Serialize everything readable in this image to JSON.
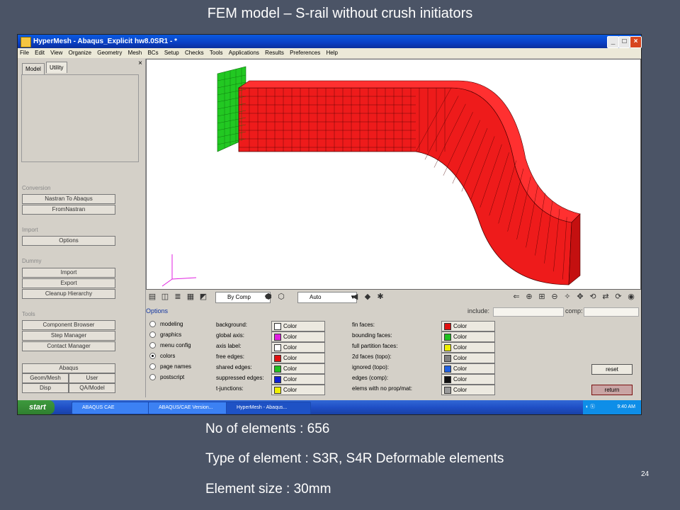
{
  "slide": {
    "title": "FEM model – S-rail without crush initiators",
    "page_number": "24",
    "bullets": [
      "No of elements : 656",
      "Type of element : S3R, S4R Deformable elements",
      "Element size : 30mm"
    ]
  },
  "window": {
    "title": "HyperMesh - Abaqus_Explicit hw8.0SR1 - *",
    "buttons": {
      "minimize": "_",
      "maximize": "□",
      "close": "×"
    }
  },
  "menu": [
    "File",
    "Edit",
    "View",
    "Organize",
    "Geometry",
    "Mesh",
    "BCs",
    "Setup",
    "Checks",
    "Tools",
    "Applications",
    "Results",
    "Preferences",
    "Help"
  ],
  "left_panel": {
    "tabs": [
      "Model",
      "Utility"
    ],
    "close": "×",
    "sections": {
      "conversion": {
        "label": "Conversion",
        "buttons": [
          "Nastran To Abaqus",
          "FromNastran"
        ]
      },
      "import": {
        "label": "Import",
        "buttons": [
          "Options"
        ]
      },
      "dummy": {
        "label": "Dummy",
        "buttons": [
          "Import",
          "Export",
          "Cleanup Hierarchy"
        ]
      },
      "tools": {
        "label": "Tools",
        "buttons": [
          "Component Browser",
          "Step Manager",
          "Contact Manager"
        ]
      },
      "abaqus": {
        "label": "Abaqus",
        "buttons": [
          "Geom/Mesh",
          "User",
          "Disp",
          "QA/Model"
        ]
      }
    }
  },
  "toolbar": {
    "color_mode": "By Comp",
    "display_mode": "Auto"
  },
  "options": {
    "title": "Options",
    "include_label": "include:",
    "comp_label": "comp:",
    "radios": [
      {
        "label": "modeling",
        "selected": false
      },
      {
        "label": "graphics",
        "selected": false
      },
      {
        "label": "menu config",
        "selected": false
      },
      {
        "label": "colors",
        "selected": true
      },
      {
        "label": "page names",
        "selected": false
      },
      {
        "label": "postscript",
        "selected": false
      }
    ],
    "left_colors": [
      {
        "label": "background:",
        "button": "Color",
        "color": "#ffffff"
      },
      {
        "label": "global axis:",
        "button": "Color",
        "color": "#e020e0"
      },
      {
        "label": "axis label:",
        "button": "Color",
        "color": "#ffffff"
      },
      {
        "label": "free edges:",
        "button": "Color",
        "color": "#e01010"
      },
      {
        "label": "shared edges:",
        "button": "Color",
        "color": "#20c020"
      },
      {
        "label": "suppressed edges:",
        "button": "Color",
        "color": "#1020d0"
      },
      {
        "label": "t-junctions:",
        "button": "Color",
        "color": "#f0f000"
      }
    ],
    "right_colors": [
      {
        "label": "fin faces:",
        "button": "Color",
        "color": "#e01010"
      },
      {
        "label": "bounding faces:",
        "button": "Color",
        "color": "#20c020"
      },
      {
        "label": "full partition faces:",
        "button": "Color",
        "color": "#f0f000"
      },
      {
        "label": "2d faces (topo):",
        "button": "Color",
        "color": "#808080"
      },
      {
        "label": "ignored (topo):",
        "button": "Color",
        "color": "#2060e0"
      },
      {
        "label": "edges (comp):",
        "button": "Color",
        "color": "#101010"
      },
      {
        "label": "elems with no prop/mat:",
        "button": "Color",
        "color": "#9a9a9a"
      }
    ],
    "reset": "reset",
    "return": "return"
  },
  "taskbar": {
    "start": "start",
    "items": [
      "ABAQUS CAE",
      "ABAQUS/CAE Version...",
      "HyperMesh - Abaqus..."
    ],
    "clock": "9:40 AM"
  }
}
